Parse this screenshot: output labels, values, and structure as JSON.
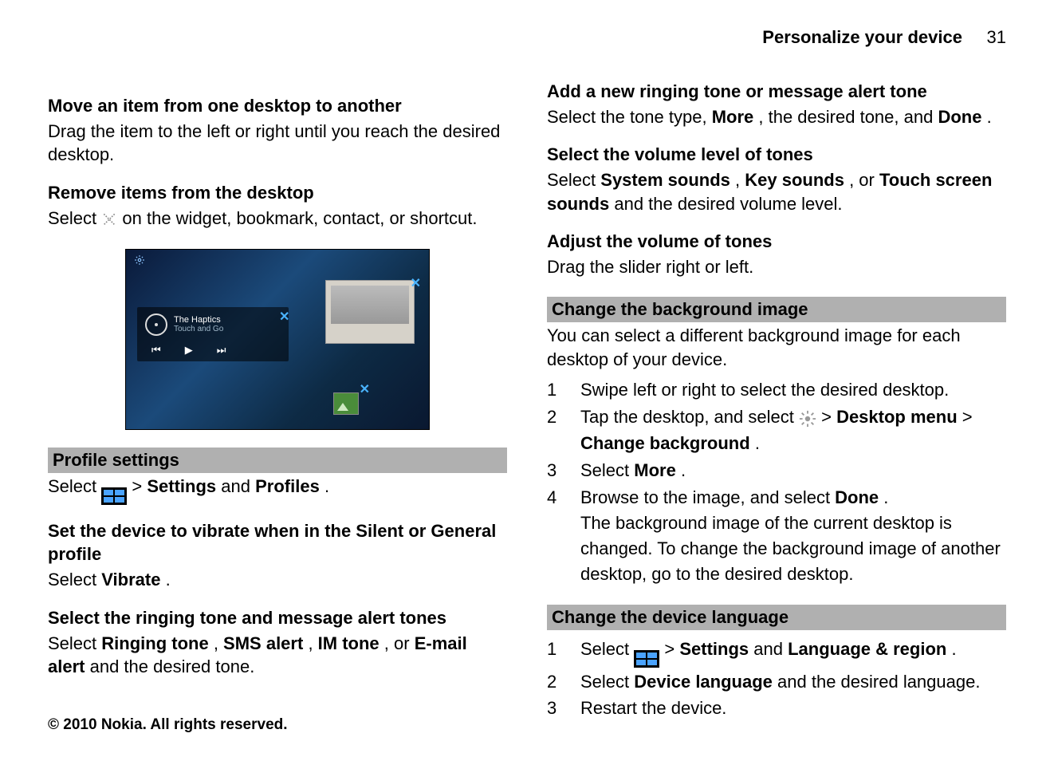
{
  "header": {
    "section": "Personalize your device",
    "page": "31"
  },
  "footer": "© 2010 Nokia. All rights reserved.",
  "left": {
    "move_h": "Move an item from one desktop to another",
    "move_p": "Drag the item to the left or right until you reach the desired desktop.",
    "remove_h": "Remove items from the desktop",
    "remove_pre": "Select ",
    "remove_post": " on the widget, bookmark, contact, or shortcut.",
    "screenshot": {
      "widget_title": "The Haptics",
      "widget_sub": "Touch and Go",
      "prev": "⏮",
      "play": "▶",
      "next": "⏭"
    },
    "profile_bar": "Profile settings",
    "profile_select_pre": "Select ",
    "profile_select_gt": " > ",
    "settings": "Settings",
    "and": " and ",
    "profiles": "Profiles",
    "period": ".",
    "vibrate_h": "Set the device to vibrate when in the Silent or General profile",
    "vibrate_pre": "Select ",
    "vibrate_b": "Vibrate",
    "vibrate_post": ".",
    "ring_h": "Select the ringing tone and message alert tones",
    "ring_pre": "Select ",
    "ring1": "Ringing tone",
    "c": ", ",
    "ring2": "SMS alert",
    "ring3": "IM tone",
    "or": ", or ",
    "ring4": "E-mail alert",
    "ring_post": " and the desired tone."
  },
  "right": {
    "add_h": "Add a new ringing tone or message alert tone",
    "add_pre": "Select the tone type, ",
    "add_b1": "More",
    "add_mid": ", the desired tone, and ",
    "add_b2": "Done",
    "add_post": ".",
    "vol_h": "Select the volume level of tones",
    "vol_pre": "Select ",
    "vol1": "System sounds",
    "vol_c": ", ",
    "vol2": "Key sounds",
    "vol_or": ", or ",
    "vol3": "Touch screen sounds",
    "vol_post": " and the desired volume level.",
    "adj_h": "Adjust the volume of tones",
    "adj_p": "Drag the slider right or left.",
    "bg_bar": "Change the background image",
    "bg_p": "You can select a different background image for each desktop of your device.",
    "bg_steps": {
      "s1": "Swipe left or right to select the desired desktop.",
      "s2_pre": "Tap the desktop, and select ",
      "s2_gt": " > ",
      "s2_b1": "Desktop menu",
      "s2_gt2": "  > ",
      "s2_b2": "Change background",
      "s2_post": ".",
      "s3_pre": "Select ",
      "s3_b": "More",
      "s3_post": ".",
      "s4_pre": "Browse to the image, and select ",
      "s4_b": "Done",
      "s4_post": ".",
      "s4_extra": "The background image of the current desktop is changed. To change the background image of another desktop, go to the desired desktop."
    },
    "lang_bar": "Change the device language",
    "lang_steps": {
      "s1_pre": "Select ",
      "gt": " > ",
      "settings": "Settings",
      "and": " and ",
      "lr": "Language & region",
      "post": ".",
      "s2_pre": "Select ",
      "s2_b": "Device language",
      "s2_post": " and the desired language.",
      "s3": "Restart the device."
    }
  }
}
